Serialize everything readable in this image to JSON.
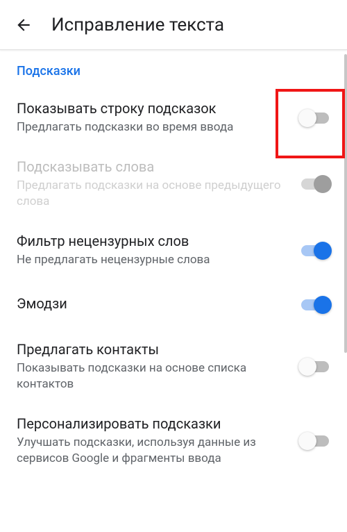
{
  "header": {
    "title": "Исправление текста"
  },
  "section_label": "Подсказки",
  "settings": {
    "show_suggestions": {
      "title": "Показывать строку подсказок",
      "sub": "Предлагать подсказки во время ввода"
    },
    "predict_words": {
      "title": "Подсказывать слова",
      "sub": "Предлагать подсказки на основе предыдущего слова"
    },
    "profanity_filter": {
      "title": "Фильтр нецензурных слов",
      "sub": "Не предлагать нецензурные слова"
    },
    "emoji": {
      "title": "Эмодзи"
    },
    "suggest_contacts": {
      "title": "Предлагать контакты",
      "sub": "Показывать подсказки на основе списка контактов"
    },
    "personalize": {
      "title": "Персонализировать подсказки",
      "sub": "Улучшать подсказки, используя данные из сервисов Google и фрагменты ввода"
    }
  }
}
